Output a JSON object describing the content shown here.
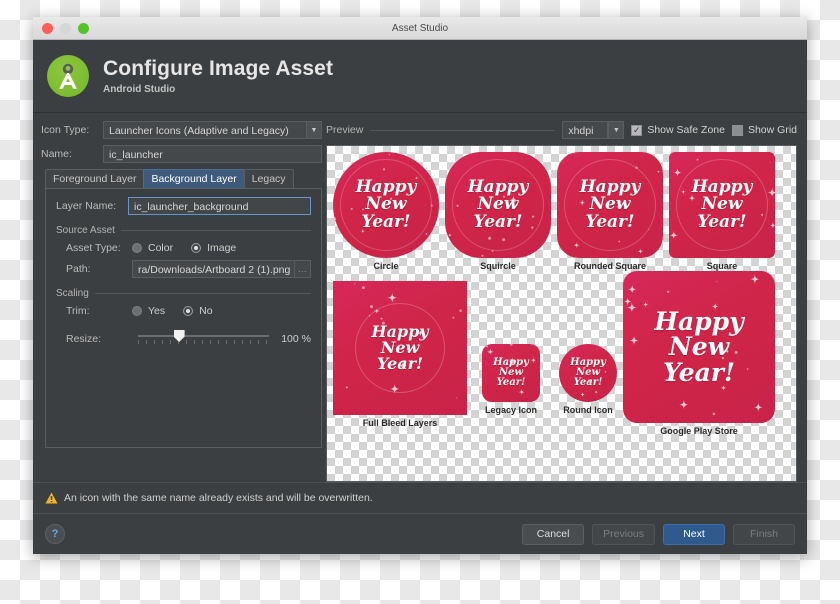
{
  "window": {
    "title": "Asset Studio",
    "traffic_lights": [
      "close-button",
      "minimize-button",
      "maximize-button"
    ]
  },
  "header": {
    "title": "Configure Image Asset",
    "subtitle": "Android Studio",
    "logo": "android-studio-logo"
  },
  "form": {
    "icon_type": {
      "label": "Icon Type:",
      "value": "Launcher Icons (Adaptive and Legacy)"
    },
    "name": {
      "label": "Name:",
      "value": "ic_launcher"
    },
    "tabs": [
      {
        "label": "Foreground Layer",
        "active": false
      },
      {
        "label": "Background Layer",
        "active": true
      },
      {
        "label": "Legacy",
        "active": false
      }
    ],
    "layer_name": {
      "label": "Layer Name:",
      "value": "ic_launcher_background"
    },
    "source_asset": {
      "section_label": "Source Asset",
      "asset_type": {
        "label": "Asset Type:",
        "options": [
          "Color",
          "Image"
        ],
        "selected": "Image"
      },
      "path": {
        "label": "Path:",
        "value": "ra/Downloads/Artboard 2 (1).png",
        "browse_label": "..."
      }
    },
    "scaling": {
      "section_label": "Scaling",
      "trim": {
        "label": "Trim:",
        "options": [
          "Yes",
          "No"
        ],
        "selected": "No"
      },
      "resize": {
        "label": "Resize:",
        "value": "100 %",
        "percent": 33
      }
    }
  },
  "preview": {
    "label": "Preview",
    "dpi": "xhdpi",
    "show_safe_zone": {
      "label": "Show Safe Zone",
      "checked": true,
      "mark": "✓"
    },
    "show_grid": {
      "label": "Show Grid",
      "checked": false
    },
    "icon_text": {
      "line1": "Happy",
      "line2": "New",
      "line3": "Year!"
    },
    "tiles": [
      {
        "caption": "Circle",
        "shape": "circle"
      },
      {
        "caption": "Squircle",
        "shape": "squircle"
      },
      {
        "caption": "Rounded Square",
        "shape": "rounded-square"
      },
      {
        "caption": "Square",
        "shape": "square"
      },
      {
        "caption": "Full Bleed Layers",
        "shape": "square"
      },
      {
        "caption": "Legacy Icon",
        "shape": "rounded-square"
      },
      {
        "caption": "Round Icon",
        "shape": "circle"
      },
      {
        "caption": "Google Play Store",
        "shape": "rounded-square"
      }
    ]
  },
  "warning": {
    "icon": "warning-triangle-icon",
    "text": "An icon with the same name already exists and will be overwritten."
  },
  "footer": {
    "help_label": "?",
    "buttons": [
      {
        "label": "Cancel",
        "state": "enabled"
      },
      {
        "label": "Previous",
        "state": "disabled"
      },
      {
        "label": "Next",
        "state": "primary"
      },
      {
        "label": "Finish",
        "state": "disabled"
      }
    ]
  },
  "colors": {
    "accent_blue": "#2e5a8e",
    "icon_red": "#cf2548",
    "logo_green": "#8cc63e",
    "warning_yellow": "#f0b429",
    "panel_bg": "#3c3f41"
  }
}
